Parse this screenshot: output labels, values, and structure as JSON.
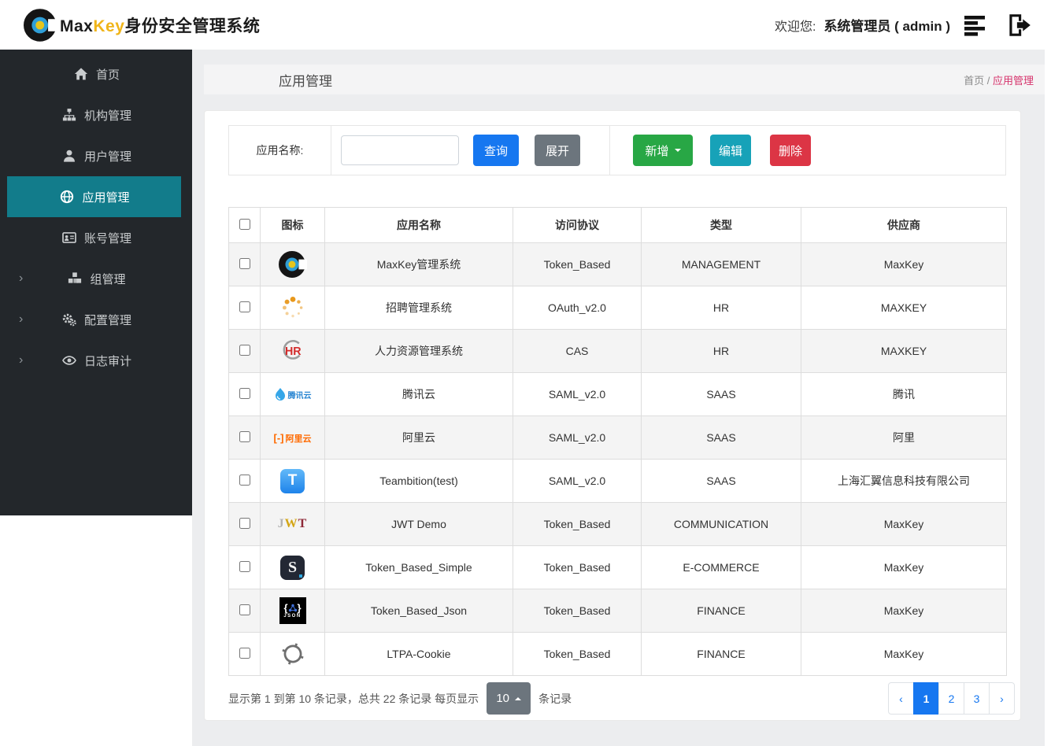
{
  "colors": {
    "accent": "#127c8b",
    "sidebar_bg": "#23272b",
    "primary": "#1677f0",
    "success": "#28a745",
    "info": "#17a2b8",
    "danger": "#dc3545",
    "secondary": "#6c757d",
    "breadcrumb_pink": "#d6336c",
    "brand_yellow": "#f0b519"
  },
  "header": {
    "brand": {
      "prefix": "Max",
      "highlight": "Key",
      "suffix": "身份安全管理系统"
    },
    "welcome_label": "欢迎您:",
    "username": "系统管理员 ( admin )"
  },
  "sidebar": {
    "items": [
      {
        "name": "home",
        "label": "首页",
        "icon": "home-icon",
        "active": false,
        "chevron": false
      },
      {
        "name": "org",
        "label": "机构管理",
        "icon": "sitemap-icon",
        "active": false,
        "chevron": false
      },
      {
        "name": "user",
        "label": "用户管理",
        "icon": "user-icon",
        "active": false,
        "chevron": false
      },
      {
        "name": "app",
        "label": "应用管理",
        "icon": "globe-icon",
        "active": true,
        "chevron": false
      },
      {
        "name": "account",
        "label": "账号管理",
        "icon": "id-card-icon",
        "active": false,
        "chevron": false
      },
      {
        "name": "group",
        "label": "组管理",
        "icon": "cubes-icon",
        "active": false,
        "chevron": true
      },
      {
        "name": "config",
        "label": "配置管理",
        "icon": "cogs-icon",
        "active": false,
        "chevron": true
      },
      {
        "name": "audit",
        "label": "日志审计",
        "icon": "eye-icon",
        "active": false,
        "chevron": true
      }
    ]
  },
  "page": {
    "title": "应用管理",
    "breadcrumb": {
      "root": "首页",
      "separator": " / ",
      "current": "应用管理"
    }
  },
  "toolbar": {
    "search_label": "应用名称:",
    "search_value": "",
    "query_label": "查询",
    "expand_label": "展开",
    "add_label": "新增",
    "edit_label": "编辑",
    "delete_label": "删除"
  },
  "table": {
    "columns": [
      "图标",
      "应用名称",
      "访问协议",
      "类型",
      "供应商"
    ],
    "rows": [
      {
        "icon": "maxkey-icon",
        "name": "MaxKey管理系统",
        "protocol": "Token_Based",
        "type": "MANAGEMENT",
        "vendor": "MaxKey"
      },
      {
        "icon": "spinner-icon",
        "name": "招聘管理系统",
        "protocol": "OAuth_v2.0",
        "type": "HR",
        "vendor": "MAXKEY"
      },
      {
        "icon": "hr-logo-icon",
        "name": "人力资源管理系统",
        "protocol": "CAS",
        "type": "HR",
        "vendor": "MAXKEY"
      },
      {
        "icon": "tencent-cloud-icon",
        "name": "腾讯云",
        "protocol": "SAML_v2.0",
        "type": "SAAS",
        "vendor": "腾讯"
      },
      {
        "icon": "aliyun-icon",
        "name": "阿里云",
        "protocol": "SAML_v2.0",
        "type": "SAAS",
        "vendor": "阿里"
      },
      {
        "icon": "teambition-icon",
        "name": "Teambition(test)",
        "protocol": "SAML_v2.0",
        "type": "SAAS",
        "vendor": "上海汇翼信息科技有限公司"
      },
      {
        "icon": "jwt-icon",
        "name": "JWT Demo",
        "protocol": "Token_Based",
        "type": "COMMUNICATION",
        "vendor": "MaxKey"
      },
      {
        "icon": "s-logo-icon",
        "name": "Token_Based_Simple",
        "protocol": "Token_Based",
        "type": "E-COMMERCE",
        "vendor": "MaxKey"
      },
      {
        "icon": "json-icon",
        "name": "Token_Based_Json",
        "protocol": "Token_Based",
        "type": "FINANCE",
        "vendor": "MaxKey"
      },
      {
        "icon": "ltpa-icon",
        "name": "LTPA-Cookie",
        "protocol": "Token_Based",
        "type": "FINANCE",
        "vendor": "MaxKey"
      }
    ]
  },
  "pagination": {
    "info_prefix": "显示第 1 到第 10 条记录，总共 22 条记录 每页显示",
    "page_size": "10",
    "info_suffix": "条记录",
    "prev": "‹",
    "next": "›",
    "pages": [
      "1",
      "2",
      "3"
    ],
    "active_page": "1"
  }
}
